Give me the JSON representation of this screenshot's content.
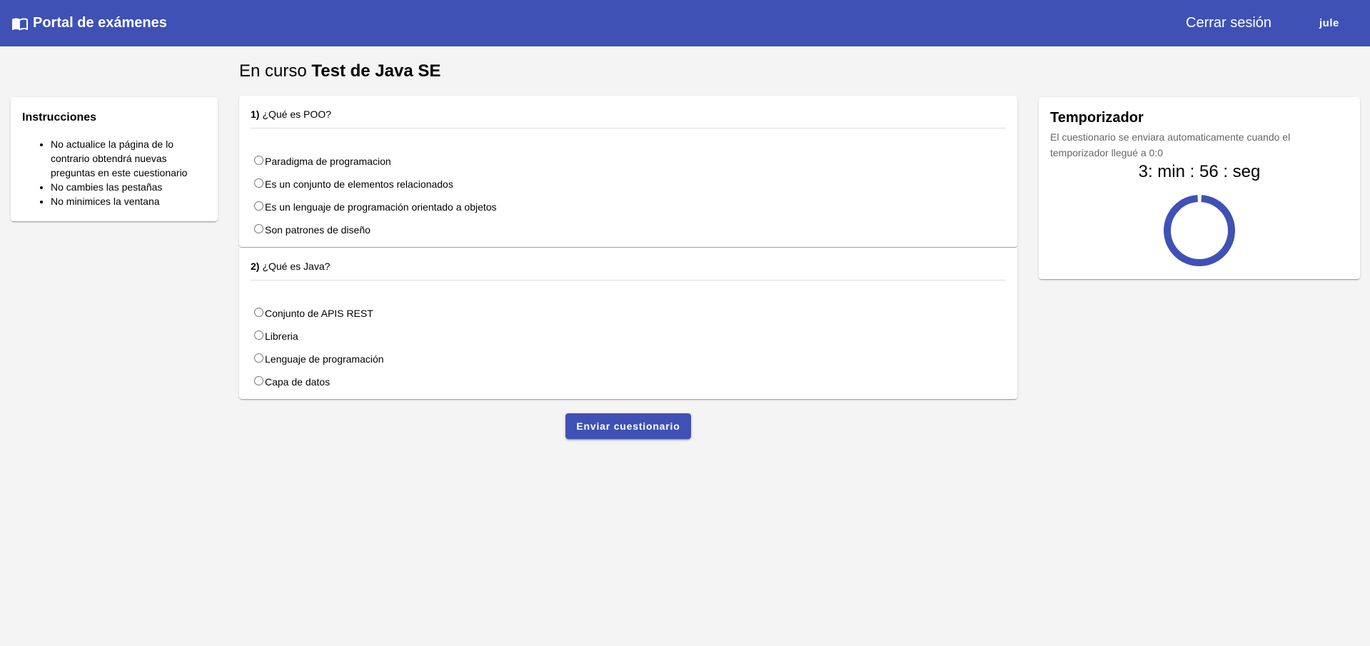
{
  "header": {
    "brand_icon": "book-open-icon",
    "brand_title": "Portal de exámenes",
    "logout_label": "Cerrar sesión",
    "user_label": "jule",
    "bg_color": "#3f51b5"
  },
  "instructions": {
    "title": "Instrucciones",
    "items": [
      "No actualice la página de lo contrario obtendrá nuevas preguntas en este cuestionario",
      "No cambies las pestañas",
      "No minimices la ventana"
    ]
  },
  "exam": {
    "title_prefix": "En curso",
    "title_name": "Test de Java SE"
  },
  "questions": [
    {
      "number": "1)",
      "text": "¿Qué es POO?",
      "options": [
        "Paradigma de programacion",
        "Es un conjunto de elementos relacionados",
        "Es un lenguaje de programación orientado a objetos",
        "Son patrones de diseño"
      ]
    },
    {
      "number": "2)",
      "text": "¿Qué es Java?",
      "options": [
        "Conjunto de APIS REST",
        "Libreria",
        "Lenguaje de programación",
        "Capa de datos"
      ]
    }
  ],
  "submit_label": "Enviar cuestionario",
  "timer": {
    "title": "Temporizador",
    "description": "El cuestionario se enviara automaticamente cuando el temporizador llegué a 0:0",
    "time_display": "3: min : 56 : seg",
    "progress_fraction": 0.98,
    "spinner_color": "#3f51b5"
  }
}
